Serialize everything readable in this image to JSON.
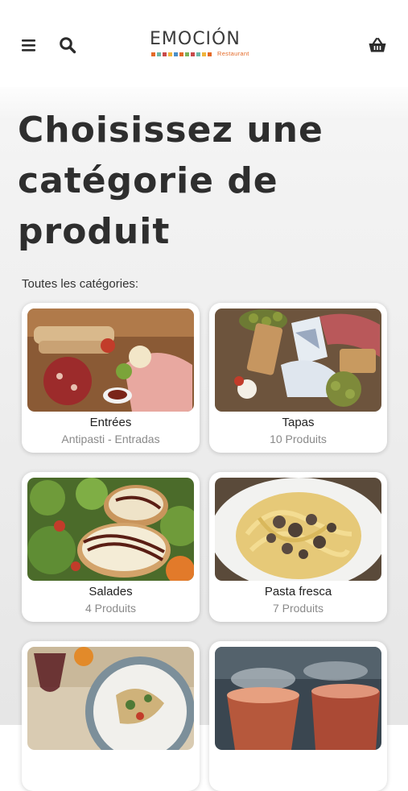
{
  "header": {
    "menu_icon": "hamburger-menu-icon",
    "search_icon": "search-icon",
    "cart_icon": "basket-icon",
    "brand_name": "EMOCIÓN",
    "brand_sub": "Restaurant"
  },
  "page": {
    "title": "Choisissez une catégorie de produit",
    "section_label": "Toutes les catégories:"
  },
  "categories": [
    {
      "name": "Entrées",
      "subtitle": "Antipasti - Entradas"
    },
    {
      "name": "Tapas",
      "subtitle": "10 Produits"
    },
    {
      "name": "Salades",
      "subtitle": "4 Produits"
    },
    {
      "name": "Pasta fresca",
      "subtitle": "7 Produits"
    },
    {
      "name": "",
      "subtitle": ""
    },
    {
      "name": "",
      "subtitle": ""
    }
  ],
  "colors": {
    "brand_accent": "#e46a28",
    "text_dark": "#2e2e2e",
    "text_muted": "#8a8a8a"
  }
}
